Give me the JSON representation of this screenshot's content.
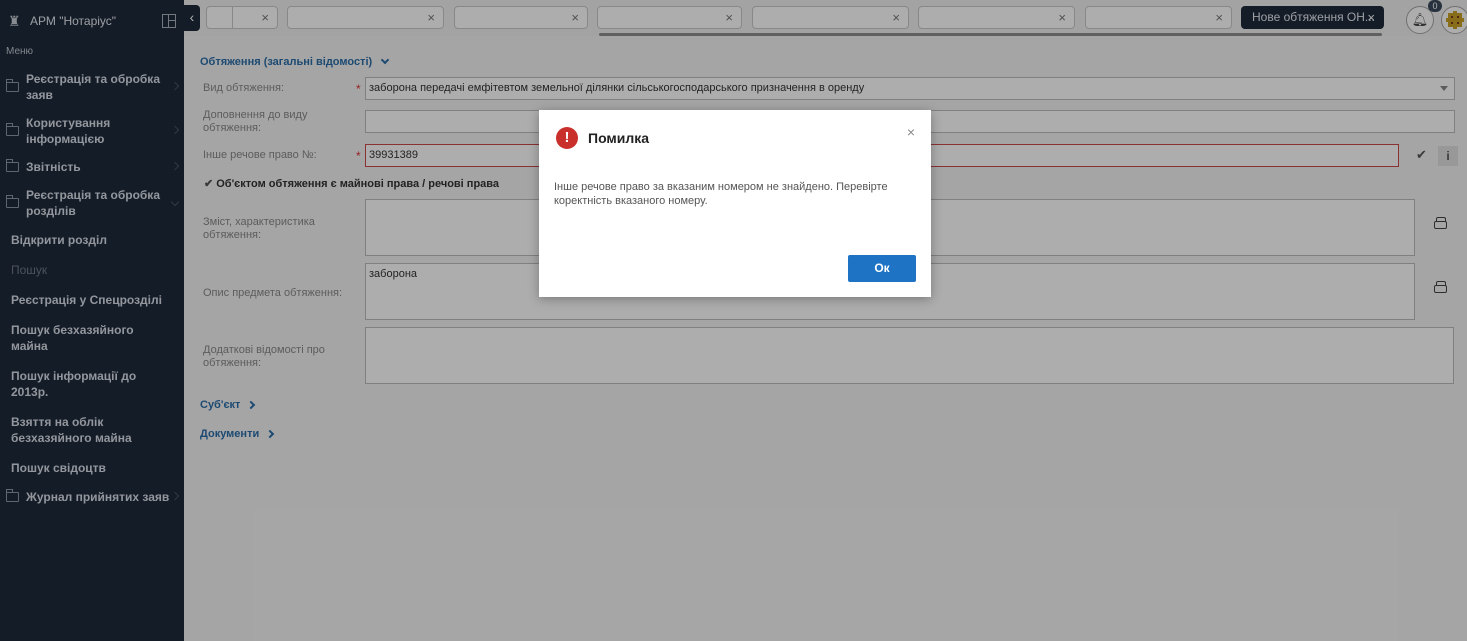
{
  "sidebar": {
    "app_title": "АРМ \"Нотаріус\"",
    "menu_label": "Меню",
    "items": [
      {
        "label": "Реєстрація та обробка заяв"
      },
      {
        "label": "Користування інформацією"
      },
      {
        "label": "Звітність"
      },
      {
        "label": "Реєстрація та обробка розділів"
      }
    ],
    "subitems": [
      {
        "label": "Відкрити розділ"
      },
      {
        "label": "Пошук"
      },
      {
        "label": "Реєстрація у Спецрозділі"
      },
      {
        "label": "Пошук безхазяйного майна"
      },
      {
        "label": "Пошук інформації до 2013р."
      },
      {
        "label": "Взяття на облік безхазяйного майна"
      },
      {
        "label": "Пошук свідоцтв"
      }
    ],
    "journal_label": "Журнал прийнятих заяв"
  },
  "topbar": {
    "active_tab": "Нове обтяження ОН...",
    "notifications_count": "0"
  },
  "form": {
    "section_title": "Обтяження (загальні відомості)",
    "kind_label": "Вид обтяження:",
    "kind_value": "заборона передачі емфітевтом земельної ділянки сільськогосподарського призначення в оренду",
    "addition_label": "Доповнення до виду обтяження:",
    "addition_value": "",
    "other_right_label": "Інше речове право №:",
    "other_right_value": "39931389",
    "checkbox_label": "Об'єктом обтяження є майнові права / речові права",
    "content_label": "Зміст, характеристика обтяження:",
    "content_value": "",
    "subject_desc_label": "Опис предмета обтяження:",
    "subject_desc_value": "заборона",
    "extra_label": "Додаткові відомості про обтяження:",
    "extra_value": "",
    "subject_section": "Суб'єкт",
    "documents_section": "Документи"
  },
  "modal": {
    "title": "Помилка",
    "message": "Інше речове право за вказаним номером не знайдено. Перевірте коректність вказаного номеру.",
    "ok_label": "Ок"
  },
  "colors": {
    "sidebar_bg": "#1e2a3b",
    "link": "#2b6ea8",
    "error": "#c9302c",
    "primary_button": "#1f73c4"
  }
}
